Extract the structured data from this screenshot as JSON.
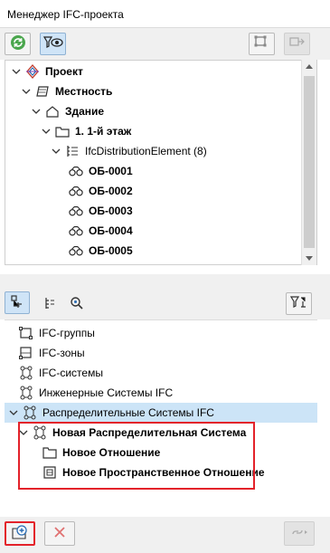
{
  "window": {
    "title": "Менеджер IFC-проекта"
  },
  "colors": {
    "accent_green": "#2e8b3d",
    "selection": "#cce4f7",
    "highlight_red": "#e3222a"
  },
  "toolbar_top": {
    "buttons": [
      {
        "icon": "refresh-icon"
      },
      {
        "icon": "filter-view-icon"
      },
      {
        "icon": "node-select-icon"
      },
      {
        "icon": "node-connect-icon"
      }
    ]
  },
  "tree1": [
    {
      "label": "Проект",
      "bold": true,
      "icon": "project-icon"
    },
    {
      "label": "Местность",
      "bold": true,
      "icon": "site-icon"
    },
    {
      "label": "Здание",
      "bold": true,
      "icon": "building-icon"
    },
    {
      "label": "1. 1-й этаж",
      "bold": true,
      "icon": "storey-icon"
    },
    {
      "label": "IfcDistributionElement (8)",
      "bold": false,
      "icon": "list-icon"
    },
    {
      "label": "ОБ-0001",
      "bold": true,
      "icon": "element-icon"
    },
    {
      "label": "ОБ-0002",
      "bold": true,
      "icon": "element-icon"
    },
    {
      "label": "ОБ-0003",
      "bold": true,
      "icon": "element-icon"
    },
    {
      "label": "ОБ-0004",
      "bold": true,
      "icon": "element-icon"
    },
    {
      "label": "ОБ-0005",
      "bold": true,
      "icon": "element-icon"
    }
  ],
  "tree2": [
    {
      "label": "IFC-группы",
      "bold": false,
      "icon": "group-icon"
    },
    {
      "label": "IFC-зоны",
      "bold": false,
      "icon": "zone-icon"
    },
    {
      "label": "IFC-системы",
      "bold": false,
      "icon": "system-icon"
    },
    {
      "label": "Инженерные Системы IFC",
      "bold": false,
      "icon": "system-icon"
    },
    {
      "label": "Распределительные Системы IFC",
      "bold": false,
      "icon": "system-icon"
    },
    {
      "label": "Новая Распределительная Система",
      "bold": true,
      "icon": "system-icon"
    },
    {
      "label": "Новое Отношение",
      "bold": true,
      "icon": "folder-icon"
    },
    {
      "label": "Новое Пространственное Отношение",
      "bold": true,
      "icon": "spatial-relation-icon"
    }
  ]
}
